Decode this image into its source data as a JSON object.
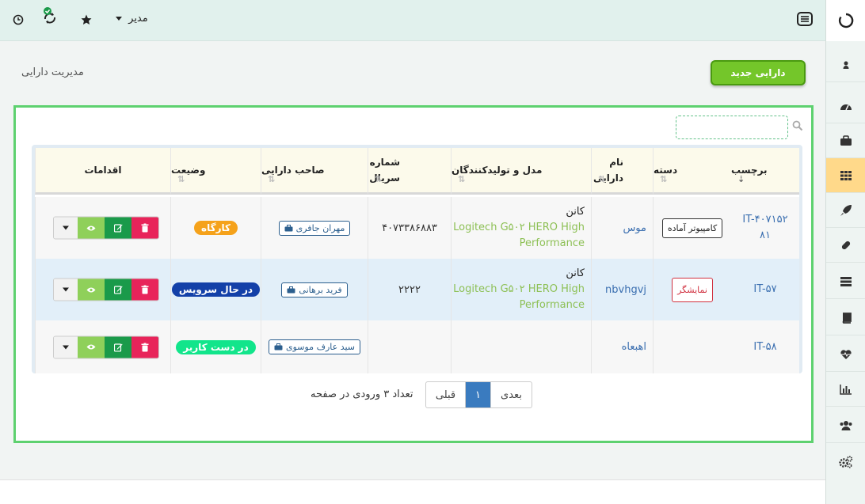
{
  "topbar": {
    "role_label": "مدیر",
    "icons": [
      "clock-icon",
      "sync-icon",
      "star-icon",
      "menu-icon"
    ]
  },
  "rail": {
    "items": [
      "user-icon",
      "dashboard-icon",
      "briefcase-icon",
      "grid-icon",
      "rocket-icon",
      "pill-icon",
      "server-icon",
      "book-icon",
      "heartbeat-icon",
      "bar-chart-icon",
      "users-icon",
      "cogs-icon"
    ],
    "active": "grid-icon"
  },
  "page": {
    "title": "مدیریت دارایی",
    "new_button": "دارایی جدید"
  },
  "search": {
    "placeholder": "",
    "value": ""
  },
  "table": {
    "columns": [
      "برچسب",
      "دسته",
      "نام دارایی",
      "مدل و تولیدکنندگان",
      "شماره سریال",
      "صاحب دارایی",
      "وضیعت",
      "اقدامات"
    ],
    "rows": [
      {
        "tag": "IT-۴۰۷۱۵۲۸۱",
        "category": "کامپیوتر آماده",
        "name": "موس",
        "brand": "کانن",
        "model": "Logitech G۵۰۲ HERO High Performance",
        "serial": "۴۰۷۳۳۸۶۸۸۳",
        "owner": "مهران جافری",
        "status": "کارگاه",
        "status_color": "#f5a21b"
      },
      {
        "tag": "IT-۵۷",
        "category": "نمایشگر",
        "name": "nbvhgvj",
        "brand": "کانن",
        "model": "Logitech G۵۰۲ HERO High Performance",
        "serial": "۲۲۲۲",
        "owner": "فرید برهانی",
        "status": "در حال سرویس",
        "status_color": "#1340a8"
      },
      {
        "tag": "IT-۵۸",
        "category": "",
        "name": "اهبعاه",
        "brand": "",
        "model": "",
        "serial": "",
        "owner": "سید عارف موسوی",
        "status": "در دست کاربر",
        "status_color": "#12e58b"
      }
    ]
  },
  "pagination": {
    "info": "تعداد ۳ ورودی در صفحه",
    "prev": "قبلی",
    "current": "۱",
    "next": "بعدی"
  },
  "colors": {
    "accent_green": "#74c62a",
    "card_border": "#5ed16f",
    "link_blue": "#3b6fb0"
  }
}
